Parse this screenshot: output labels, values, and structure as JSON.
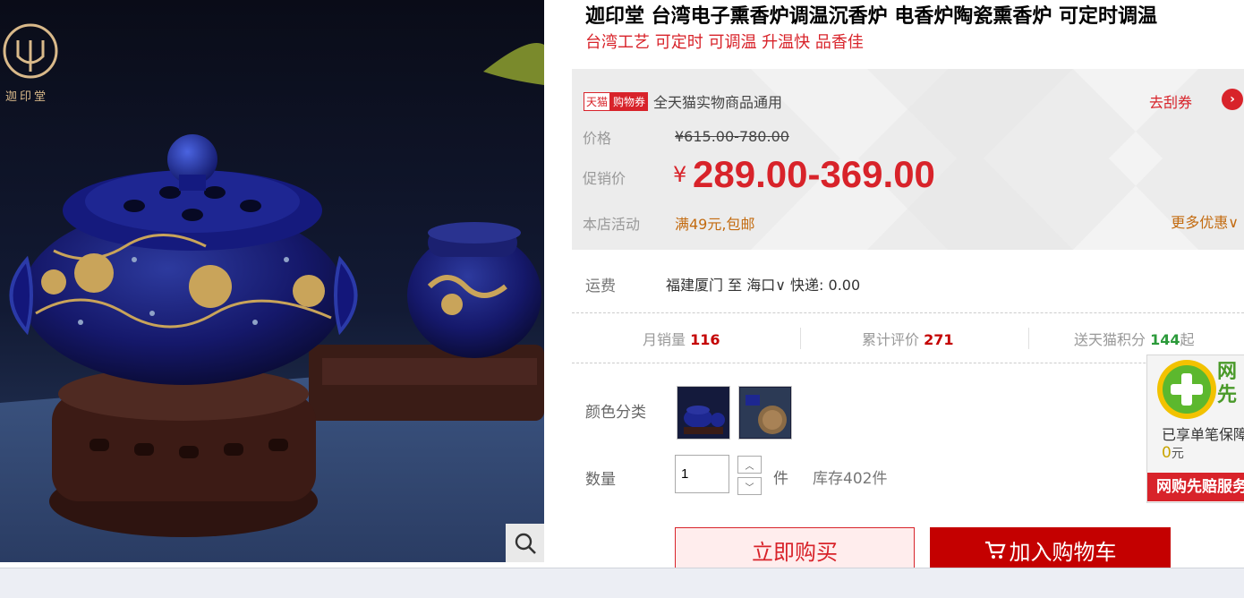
{
  "product": {
    "title": "迦印堂 台湾电子熏香炉调温沉香炉 电香炉陶瓷熏香炉 可定时调温",
    "subtitle": "台湾工艺 可定时 可调温 升温快 品香佳",
    "brand_logo_text": "迦印堂"
  },
  "coupon": {
    "tag_tmall": "天猫",
    "tag_coupon": "购物券",
    "text": "全天猫实物商品通用",
    "action": "去刮券"
  },
  "price": {
    "label_price": "价格",
    "original": "¥615.00-780.00",
    "label_promo": "促销价",
    "currency": "¥",
    "current": "289.00-369.00",
    "label_activity": "本店活动",
    "activity": "满49元,包邮",
    "more": "更多优惠"
  },
  "shipping": {
    "label": "运费",
    "from": "福建厦门",
    "to_word": "至",
    "to": "海口",
    "method": "快递: 0.00"
  },
  "stats": {
    "monthly_label": "月销量",
    "monthly": "116",
    "reviews_label": "累计评价",
    "reviews": "271",
    "points_label": "送天猫积分",
    "points": "144",
    "points_suffix": "起"
  },
  "sku": {
    "color_label": "颜色分类",
    "qty_label": "数量",
    "qty_value": "1",
    "unit": "件",
    "stock": "库存402件"
  },
  "buttons": {
    "buy": "立即购买",
    "cart": "加入购物车"
  },
  "float_ad": {
    "head": "网先",
    "line1": "已享单笔保障",
    "line2_num": "0",
    "line2_unit": "元",
    "banner": "网购先赔服务"
  },
  "colors": {
    "accent_red": "#d8232a",
    "deep_red": "#c40000",
    "promo_orange": "#c36b10",
    "points_green": "#2b9a3a"
  }
}
